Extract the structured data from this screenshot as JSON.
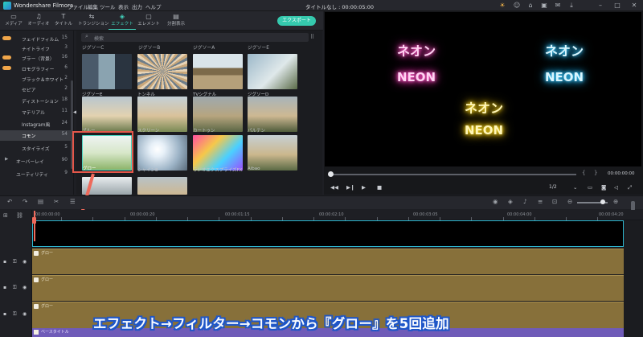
{
  "titlebar": {
    "app_name": "Wondershare Filmora",
    "menus": [
      "ファイル",
      "編集",
      "ツール",
      "表示",
      "出力",
      "ヘルプ"
    ],
    "document": "タイトルなし : 00:00:05:00"
  },
  "toolbar": {
    "tabs": [
      {
        "label": "メディア",
        "icon": "folder-icon"
      },
      {
        "label": "オーディオ",
        "icon": "music-icon"
      },
      {
        "label": "タイトル",
        "icon": "text-icon"
      },
      {
        "label": "トランジション",
        "icon": "transition-icon"
      },
      {
        "label": "エフェクト",
        "icon": "effects-icon"
      },
      {
        "label": "エレメント",
        "icon": "element-icon"
      },
      {
        "label": "分割表示",
        "icon": "split-screen-icon"
      }
    ],
    "active_tab": "エフェクト",
    "export_label": "エクスポート"
  },
  "sidebar": {
    "categories": [
      {
        "label": "フェイドフィルム",
        "count": "15",
        "badge": true
      },
      {
        "label": "ナイトライフ",
        "count": "3",
        "badge": false
      },
      {
        "label": "ブラー（背景）",
        "count": "16",
        "badge": true
      },
      {
        "label": "ロモグラフィー",
        "count": "6",
        "badge": true
      },
      {
        "label": "ブラック＆ホワイト",
        "count": "2",
        "badge": false
      },
      {
        "label": "セピア",
        "count": "2",
        "badge": false
      },
      {
        "label": "ディストーション",
        "count": "18",
        "badge": false
      },
      {
        "label": "マテリアル",
        "count": "11",
        "badge": false
      },
      {
        "label": "Instagram風",
        "count": "24",
        "badge": false
      },
      {
        "label": "コモン",
        "count": "54",
        "badge": false,
        "selected": true
      },
      {
        "label": "スタイライズ",
        "count": "5",
        "badge": false
      },
      {
        "label": "オーバーレイ",
        "count": "90",
        "badge": false,
        "expander": true
      },
      {
        "label": "ユーティリティ",
        "count": "9",
        "badge": false
      }
    ]
  },
  "browser": {
    "search_placeholder": "検索",
    "header_labels": [
      "ジグソーC",
      "ジグソーB",
      "ジグソーA",
      "ジグソーE"
    ],
    "rows": [
      [
        "ジグソーE",
        "トンネル",
        "TVシグナル",
        "ジグソーD"
      ],
      [
        "ブルー",
        "スクリーン",
        "カートゥン",
        "パルテン"
      ],
      [
        "グロー",
        "シャイン8",
        "ラジオエクスプライズFX",
        "Aibao"
      ]
    ],
    "selected_item": "グロー"
  },
  "preview": {
    "texts": [
      {
        "jp": "ネオン",
        "en": "NEON",
        "color": "#ff6cd2"
      },
      {
        "jp": "ネオン",
        "en": "NEON",
        "color": "#5ad8ff"
      },
      {
        "jp": "ネオン",
        "en": "NEON",
        "color": "#ffe12a"
      }
    ],
    "timecode": "00:00:00:00",
    "ratio": "1/2"
  },
  "timeline": {
    "ruler": [
      "00:00:00:00",
      "00:00:00:20",
      "00:00:01:15",
      "00:00:02:10",
      "00:00:03:05",
      "00:00:04:00",
      "00:00:04:20"
    ],
    "effect_clips": [
      "グロー",
      "グロー",
      "グロー"
    ],
    "title_clip": "ベースタイトル"
  },
  "caption": "エフェクト→フィルター→コモンから『グロー』を5回追加",
  "colors": {
    "accent": "#43d3bd",
    "export": "#35c9ae",
    "annotation_red": "#e4574a",
    "caption_outline": "#1e56c8",
    "effect_clip": "#87703a"
  }
}
